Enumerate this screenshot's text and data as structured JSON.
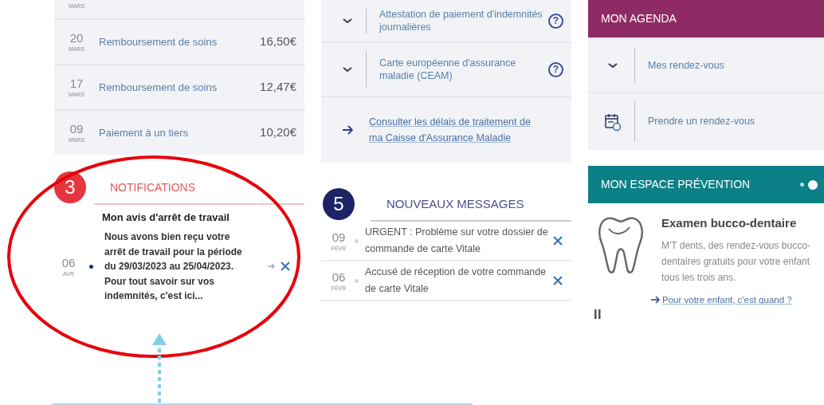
{
  "payments": {
    "partial_month": "MARS",
    "rows": [
      {
        "day": "20",
        "month": "MARS",
        "label": "Remboursement de soins",
        "amount": "16,50€"
      },
      {
        "day": "17",
        "month": "MARS",
        "label": "Remboursement de soins",
        "amount": "12,47€"
      },
      {
        "day": "09",
        "month": "MARS",
        "label": "Paiement à un tiers",
        "amount": "10,20€"
      }
    ]
  },
  "notifications": {
    "count": "3",
    "title": "NOTIFICATIONS",
    "items": [
      {
        "day": "06",
        "month": "AVR",
        "title": "Mon avis d'arrêt de travail",
        "body": "Nous avons bien reçu votre arrêt de travail pour la période du 29/03/2023 au 25/04/2023. Pour tout savoir sur vos indemnités, c'est ici...",
        "unread": true
      }
    ]
  },
  "services": {
    "items": [
      {
        "kind": "expand",
        "label": "Attestation de paiement d'indemnités journalières",
        "help": "?"
      },
      {
        "kind": "expand",
        "label": "Carte européenne d'assurance maladie (CEAM)",
        "help": "?"
      },
      {
        "kind": "link",
        "label": "Consulter les délais de traitement de ma Caisse d'Assurance Maladie"
      }
    ]
  },
  "messages": {
    "count": "5",
    "title": "NOUVEAUX MESSAGES",
    "items": [
      {
        "day": "09",
        "month": "FÉVR",
        "text": "URGENT : Problème sur votre dossier de commande de carte Vitale",
        "unread": false
      },
      {
        "day": "06",
        "month": "FÉVR",
        "text": "Accusé de réception de votre commande de carte Vitale",
        "unread": false
      }
    ]
  },
  "agenda": {
    "title": "MON AGENDA",
    "items": [
      {
        "kind": "expand",
        "label": "Mes rendez-vous"
      },
      {
        "kind": "calendar",
        "label": "Prendre un rendez-vous"
      }
    ]
  },
  "prevention": {
    "title": "MON ESPACE PRÉVENTION",
    "slides": [
      {
        "selected": false
      },
      {
        "selected": true
      }
    ],
    "card": {
      "title": "Examen bucco-dentaire",
      "text": "M'T dents, des rendez-vous bucco-dentaires gratuits pour votre enfant tous les trois ans.",
      "link": "Pour votre enfant, c'est quand ?"
    }
  }
}
